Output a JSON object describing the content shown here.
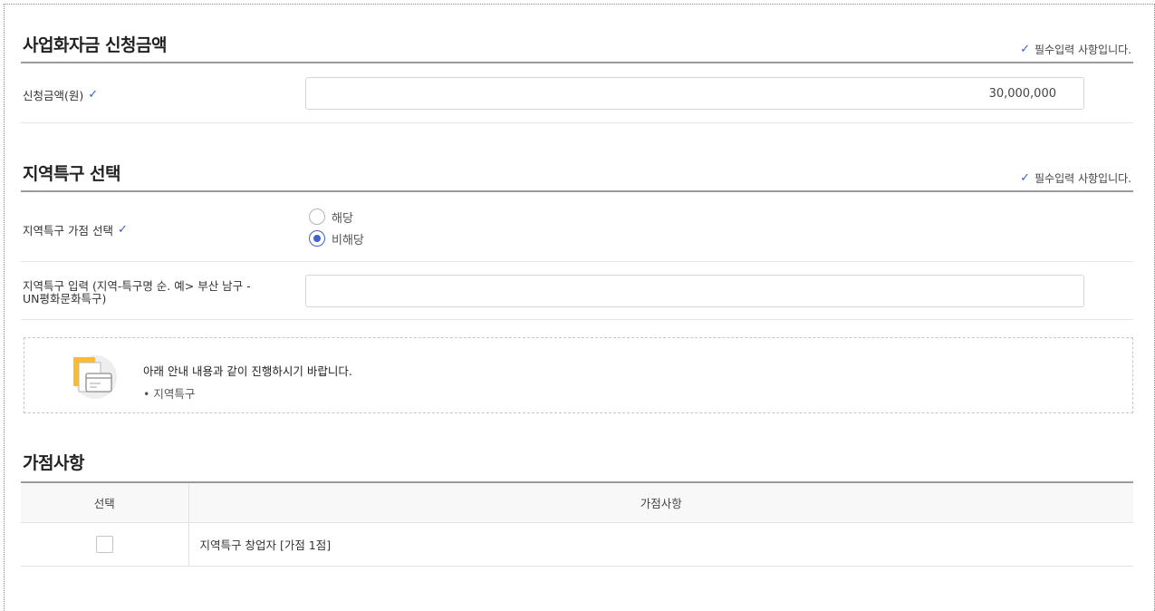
{
  "required_note": "필수입력 사항입니다.",
  "check_icon": "checkmark-icon",
  "accent_color": "#3f63c8",
  "funding": {
    "title": "사업화자금 신청금액",
    "amount_label": "신청금액(원)",
    "amount_value": "30,000,000"
  },
  "region": {
    "title": "지역특구 선택",
    "select_label": "지역특구 가점 선택",
    "options": [
      {
        "label": "해당",
        "selected": false
      },
      {
        "label": "비해당",
        "selected": true
      }
    ],
    "input_label_line1": "지역특구 입력 (지역-특구명 순. 예> 부산 남구 -",
    "input_label_line2": "UN평화문화특구)",
    "input_value": ""
  },
  "notice": {
    "icon": "document-card-icon",
    "main_text": "아래 안내 내용과 같이 진행하시기 바랍니다.",
    "item_text": "• 지역특구"
  },
  "bonus": {
    "title": "가점사항",
    "col_select": "선택",
    "col_item": "가점사항",
    "rows": [
      {
        "label": "지역특구 창업자 [가점 1점]",
        "checked": false
      }
    ]
  }
}
